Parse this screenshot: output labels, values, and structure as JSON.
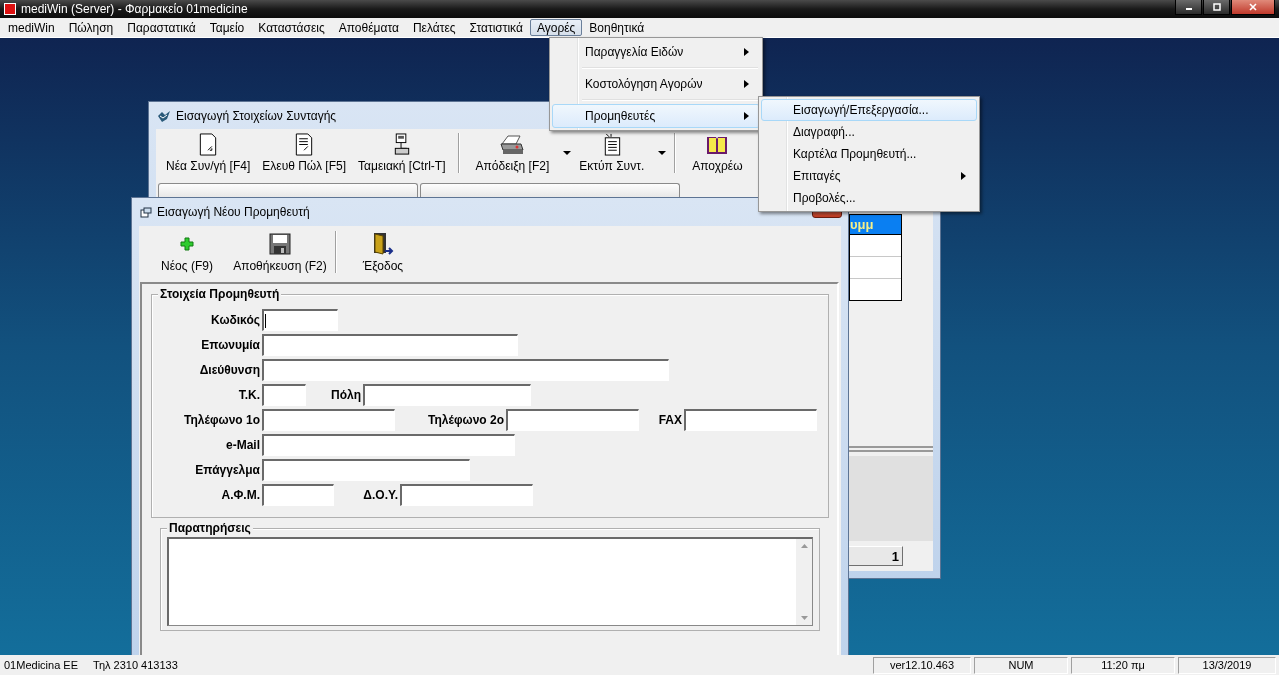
{
  "app_window": {
    "title": "mediWin (Server) - Φαρμακείο 01medicine"
  },
  "menu_bar": [
    {
      "label": "mediWin",
      "selected": false
    },
    {
      "label": "Πώληση",
      "selected": false
    },
    {
      "label": "Παραστατικά",
      "selected": false
    },
    {
      "label": "Ταμείο",
      "selected": false
    },
    {
      "label": "Καταστάσεις",
      "selected": false
    },
    {
      "label": "Αποθέματα",
      "selected": false
    },
    {
      "label": "Πελάτες",
      "selected": false
    },
    {
      "label": "Στατιστικά",
      "selected": false
    },
    {
      "label": "Αγορές",
      "selected": true
    },
    {
      "label": "Βοηθητικά",
      "selected": false
    }
  ],
  "open_menu": [
    {
      "label": "Παραγγελία Ειδών",
      "has_submenu": true,
      "selected": false
    },
    {
      "label": "Κοστολόγηση Αγορών",
      "has_submenu": true,
      "selected": false
    },
    {
      "label": "Προμηθευτές",
      "has_submenu": true,
      "selected": true
    }
  ],
  "submenu": [
    {
      "label": "Εισαγωγή/Επεξεργασία...",
      "has_submenu": false,
      "selected": true
    },
    {
      "label": "Διαγραφή...",
      "has_submenu": false,
      "selected": false
    },
    {
      "label": "Καρτέλα Προμηθευτή...",
      "has_submenu": false,
      "selected": false
    },
    {
      "label": "Επιταγές",
      "has_submenu": true,
      "selected": false
    },
    {
      "label": "Προβολές...",
      "has_submenu": false,
      "selected": false
    }
  ],
  "back_window": {
    "title": "Εισαγωγή Στοιχείων Συνταγής",
    "toolbar": [
      [
        {
          "label": "Νέα Συν/γή [F4]",
          "dropdown": false
        },
        {
          "label": "Ελευθ Πώλ [F5]",
          "dropdown": false
        },
        {
          "label": "Ταμειακή [Ctrl-T]",
          "dropdown": false
        }
      ],
      [
        {
          "label": "Απόδειξη [F2]",
          "dropdown": true
        },
        {
          "label": "Εκτύπ Συντ.",
          "dropdown": true
        }
      ],
      [
        {
          "label": "Αποχρέω",
          "dropdown": false
        }
      ]
    ],
    "table": {
      "column_1": "υμμ"
    },
    "counter": "1"
  },
  "front_window": {
    "title": "Εισαγωγή Νέου Προμηθευτή",
    "toolbar": [
      [
        {
          "label": "Νέος (F9)"
        },
        {
          "label": "Αποθήκευση (F2)"
        }
      ],
      [
        {
          "label": "Έξοδος"
        }
      ]
    ],
    "details": {
      "title": "Στοιχεία Προμηθευτή",
      "rows": [
        [
          {
            "label": "Κωδικός",
            "focused": true
          }
        ],
        [
          {
            "label": "Επωνυμία",
            "focused": false
          }
        ],
        [
          {
            "label": "Διεύθυνση",
            "focused": false
          }
        ],
        [
          {
            "label": "Τ.Κ.",
            "focused": false
          },
          {
            "label": "Πόλη",
            "focused": false
          }
        ],
        [
          {
            "label": "Τηλέφωνο 1ο",
            "focused": false
          },
          {
            "label": "Τηλέφωνο 2ο",
            "focused": false
          },
          {
            "label": "FAX",
            "focused": false
          }
        ],
        [
          {
            "label": "e-Mail",
            "focused": false
          }
        ],
        [
          {
            "label": "Επάγγελμα",
            "focused": false
          }
        ],
        [
          {
            "label": "Α.Φ.Μ.",
            "focused": false
          },
          {
            "label": "Δ.Ο.Υ.",
            "focused": false
          }
        ]
      ]
    },
    "notes": {
      "title": "Παρατηρήσεις"
    }
  },
  "status_bar": {
    "company": "01Medicina ΕΕ",
    "phone": "Τηλ 2310 413133",
    "panels": [
      "ver12.10.463",
      "NUM",
      "11:20 πμ",
      "13/3/2019"
    ]
  }
}
